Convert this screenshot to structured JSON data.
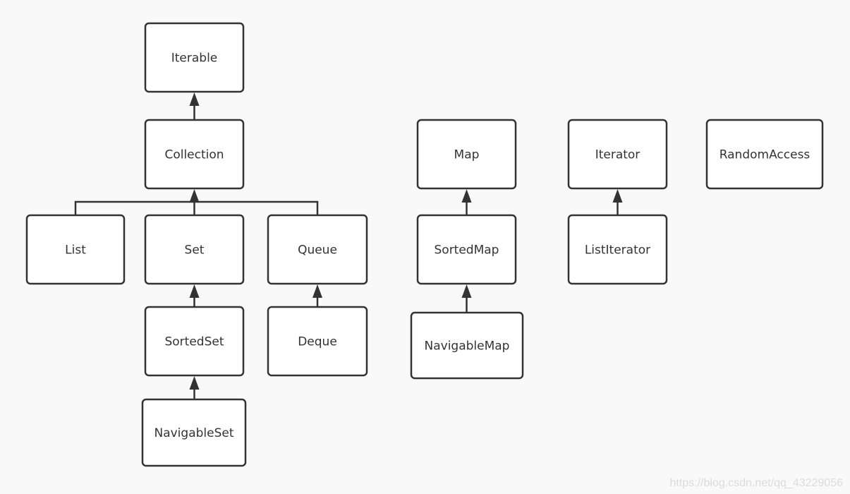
{
  "nodes": [
    {
      "id": "iterable",
      "label": "Iterable"
    },
    {
      "id": "collection",
      "label": "Collection"
    },
    {
      "id": "list",
      "label": "List"
    },
    {
      "id": "set",
      "label": "Set"
    },
    {
      "id": "queue",
      "label": "Queue"
    },
    {
      "id": "sortedset",
      "label": "SortedSet"
    },
    {
      "id": "deque",
      "label": "Deque"
    },
    {
      "id": "navigableset",
      "label": "NavigableSet"
    },
    {
      "id": "map",
      "label": "Map"
    },
    {
      "id": "sortedmap",
      "label": "SortedMap"
    },
    {
      "id": "navigablemap",
      "label": "NavigableMap"
    },
    {
      "id": "iterator",
      "label": "Iterator"
    },
    {
      "id": "listiterator",
      "label": "ListIterator"
    },
    {
      "id": "randomaccess",
      "label": "RandomAccess"
    }
  ],
  "edges": [
    {
      "from": "collection",
      "to": "iterable"
    },
    {
      "from": "list",
      "to": "collection"
    },
    {
      "from": "set",
      "to": "collection"
    },
    {
      "from": "queue",
      "to": "collection"
    },
    {
      "from": "sortedset",
      "to": "set"
    },
    {
      "from": "navigableset",
      "to": "sortedset"
    },
    {
      "from": "deque",
      "to": "queue"
    },
    {
      "from": "sortedmap",
      "to": "map"
    },
    {
      "from": "navigablemap",
      "to": "sortedmap"
    },
    {
      "from": "listiterator",
      "to": "iterator"
    }
  ],
  "edge_style": "inheritance arrow (filled triangle)",
  "watermark": "https://blog.csdn.net/qq_43229056"
}
